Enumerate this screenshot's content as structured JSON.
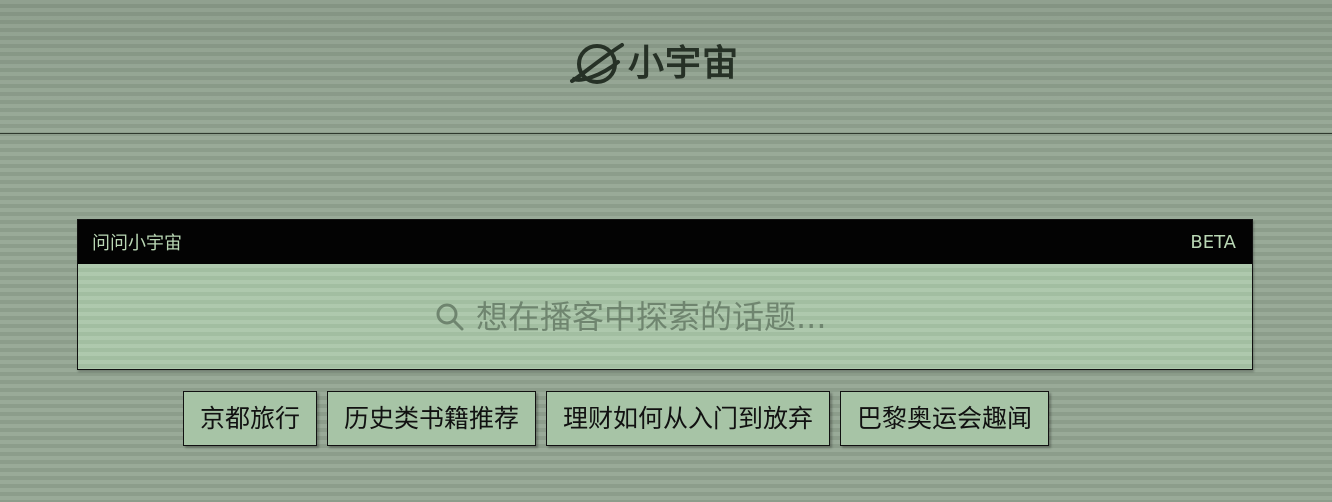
{
  "header": {
    "logo_text": "小宇宙"
  },
  "ask": {
    "title": "问问小宇宙",
    "badge": "BETA",
    "placeholder": "想在播客中探索的话题..."
  },
  "suggestions": [
    {
      "label": "京都旅行"
    },
    {
      "label": "历史类书籍推荐"
    },
    {
      "label": "理财如何从入门到放弃"
    },
    {
      "label": "巴黎奥运会趣闻"
    }
  ],
  "icons": {
    "logo": "planet-icon",
    "search": "search-icon"
  },
  "colors": {
    "background": "#93a592",
    "panel": "#a7c4a6",
    "header_bar": "#030303",
    "accent_text": "#b9d7b4",
    "placeholder": "#6f856f"
  }
}
